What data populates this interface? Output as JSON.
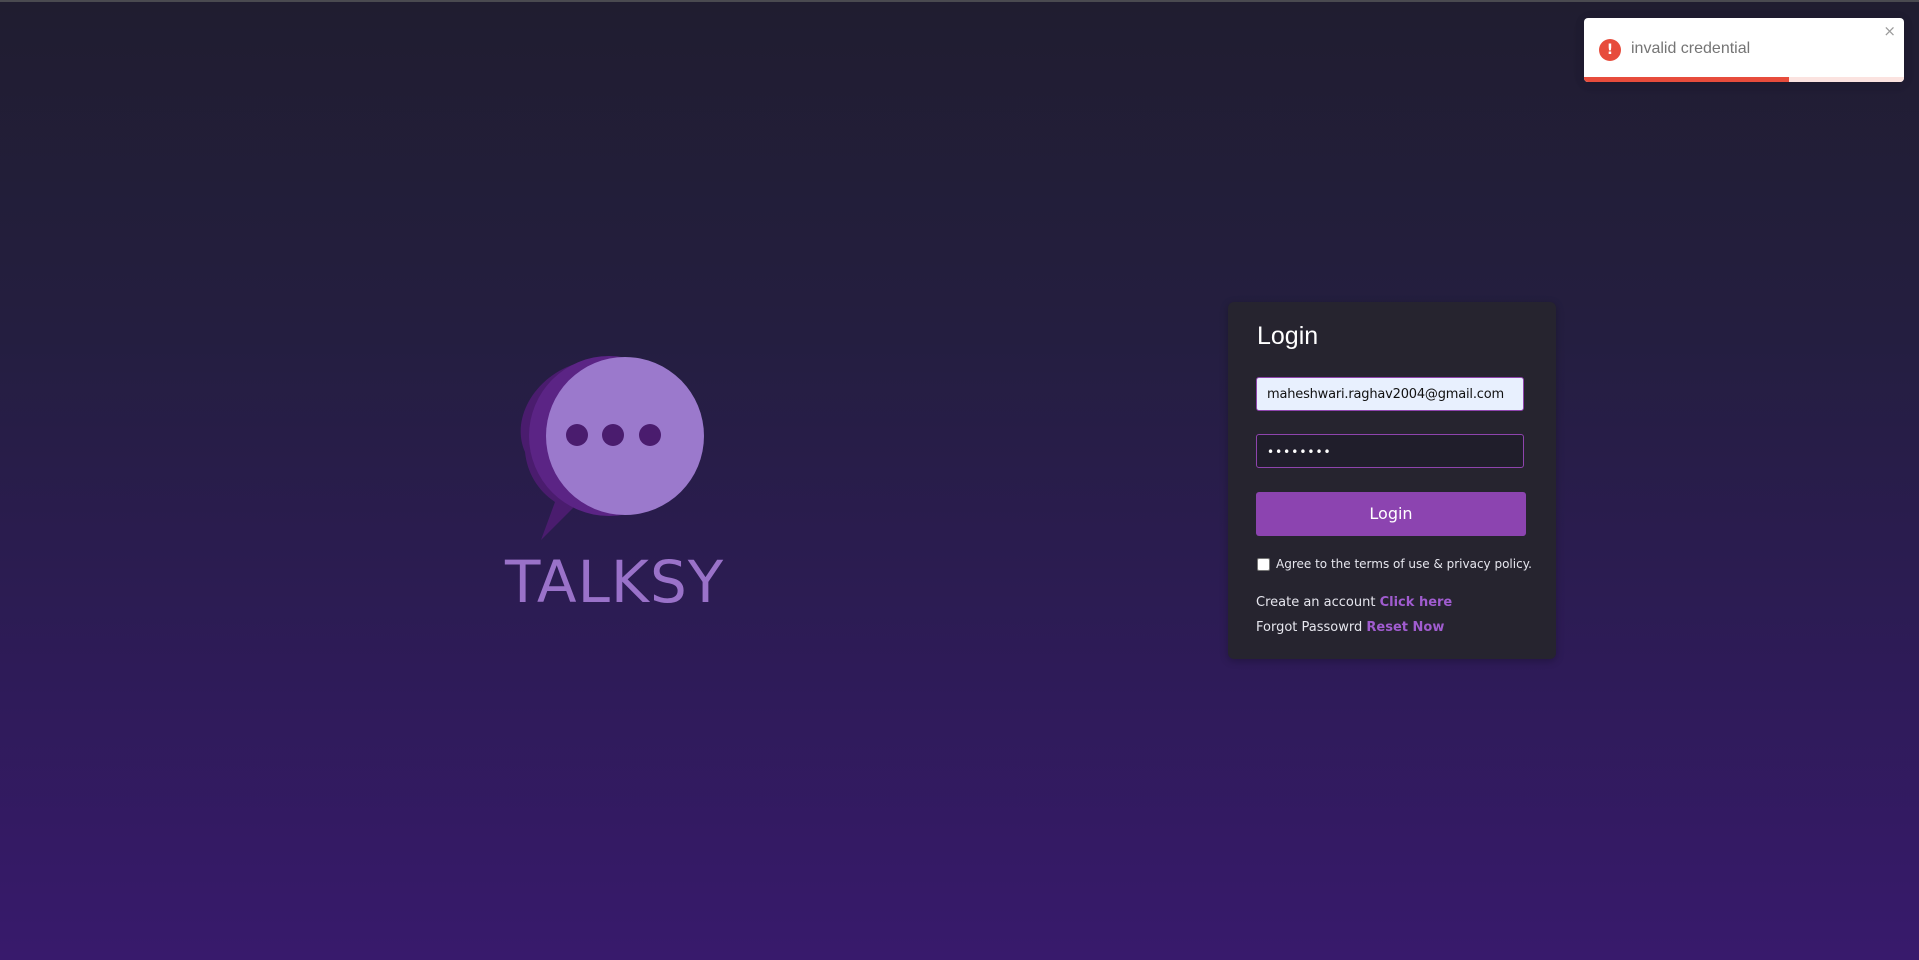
{
  "brand": {
    "name": "TALKSY",
    "logo_icon": "speech-bubble-icon",
    "logo_color": "#9b79cc"
  },
  "login_form": {
    "title": "Login",
    "email_value": "maheshwari.raghav2004@gmail.com",
    "password_value": "••••••••",
    "submit_label": "Login",
    "agree_label": "Agree to the terms of use & privacy policy.",
    "agree_checked": false,
    "create_account_text": "Create an account",
    "create_account_link": "Click here",
    "forgot_text": "Forgot Passowrd",
    "forgot_link": "Reset Now",
    "accent_color": "#8c44b0"
  },
  "toast": {
    "message": "invalid credential",
    "icon": "error-icon",
    "close_glyph": "×",
    "progress_fraction": 0.64,
    "color": "#e74c3c"
  }
}
